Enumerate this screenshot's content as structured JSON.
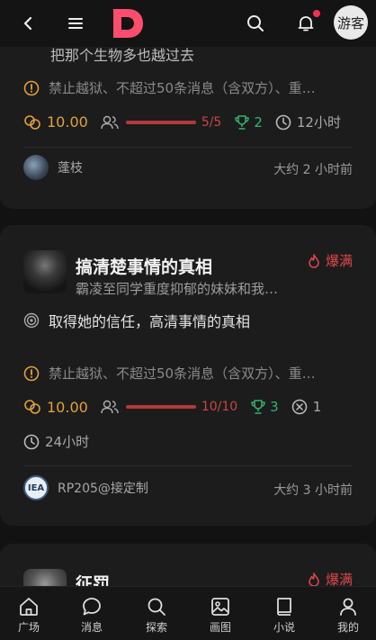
{
  "header": {
    "back_icon": "chevron-left-icon",
    "menu_icon": "menu-icon",
    "logo_icon": "app-logo",
    "search_icon": "search-icon",
    "bell_icon": "bell-icon",
    "guest_label": "游客"
  },
  "cards": [
    {
      "partial_title": "把那个生物多也越过去",
      "rules": "禁止越狱、不超过50条消息（含双方）、重…",
      "price": "10.00",
      "players": "5/5",
      "trophies": "2",
      "duration": "12小时",
      "author": "蓬枝",
      "ago": "大约 2 小时前"
    },
    {
      "title": "搞清楚事情的真相",
      "subtitle": "霸凌至同学重度抑郁的妹妹和我…",
      "hot_label": "爆满",
      "goal": "取得她的信任，高清事情的真相",
      "rules": "禁止越狱、不超过50条消息（含双方）、重…",
      "price": "10.00",
      "players": "10/10",
      "trophies": "3",
      "fails": "1",
      "duration": "24小时",
      "author": "RP205@接定制",
      "author_badge": "IEA",
      "ago": "大约 3 小时前"
    },
    {
      "title": "征罚",
      "hot_label": "爆满"
    }
  ],
  "nav": [
    {
      "label": "广场",
      "icon": "home-icon"
    },
    {
      "label": "消息",
      "icon": "chat-icon"
    },
    {
      "label": "探索",
      "icon": "search-icon"
    },
    {
      "label": "画图",
      "icon": "image-icon"
    },
    {
      "label": "小说",
      "icon": "book-icon"
    },
    {
      "label": "我的",
      "icon": "user-icon"
    }
  ],
  "colors": {
    "accent": "#ff4d6d",
    "price": "#e0a23a",
    "trophy": "#33b36a",
    "hot": "#e0474c"
  }
}
